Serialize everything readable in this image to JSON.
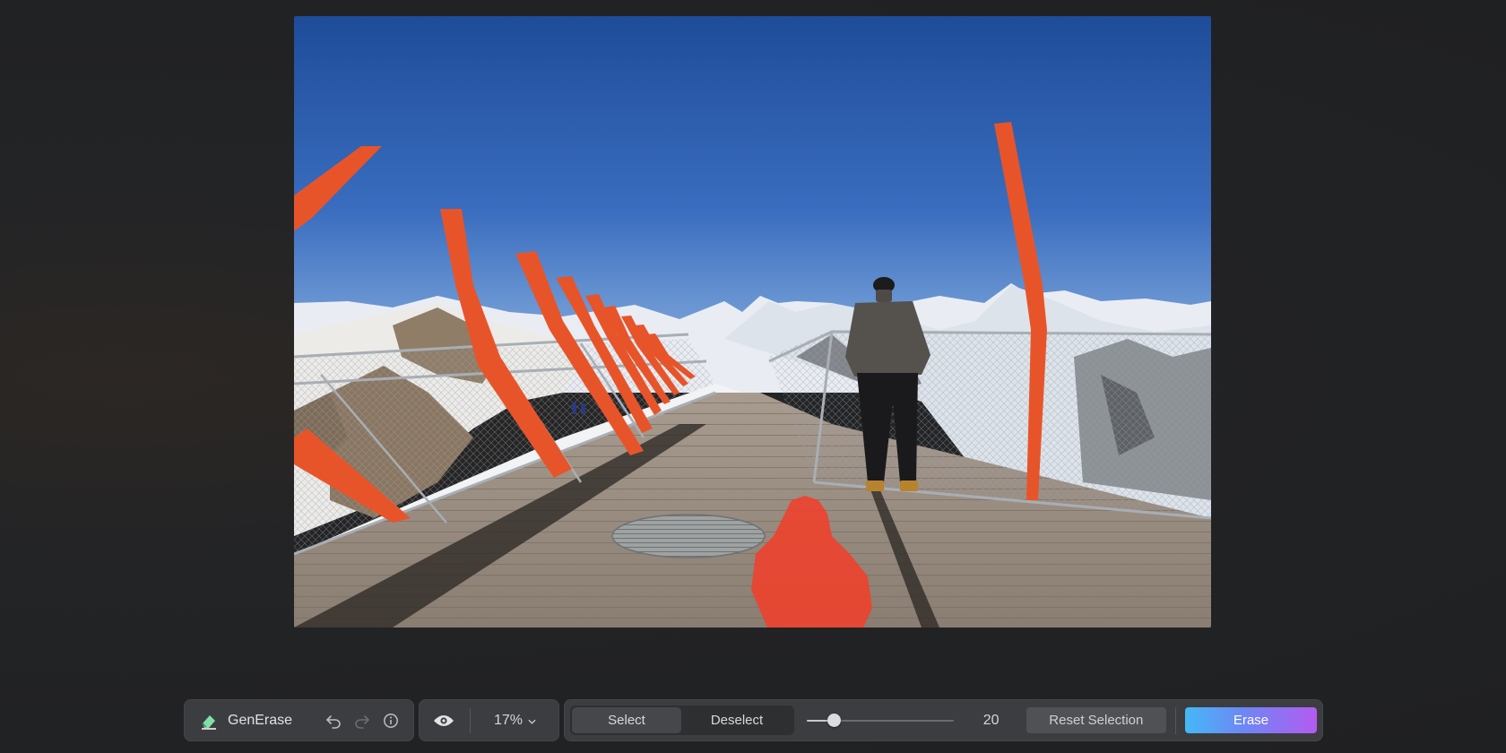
{
  "app": {
    "name": "GenErase"
  },
  "toolbar": {
    "brand_icon": "eraser-icon",
    "undo_icon": "undo-icon",
    "redo_icon": "redo-icon",
    "info_icon": "info-icon",
    "preview_icon": "eye-icon",
    "zoom_label": "17%",
    "select_label": "Select",
    "deselect_label": "Deselect",
    "mode_selected": "Select",
    "brush_size": "20",
    "brush_level": 0.15,
    "reset_label": "Reset Selection",
    "erase_label": "Erase"
  },
  "colors": {
    "accent_gradient_start": "#45b8f6",
    "accent_gradient_end": "#b35bf0",
    "selection_mask": "#f0402a",
    "railing_orange": "#e8542a"
  }
}
